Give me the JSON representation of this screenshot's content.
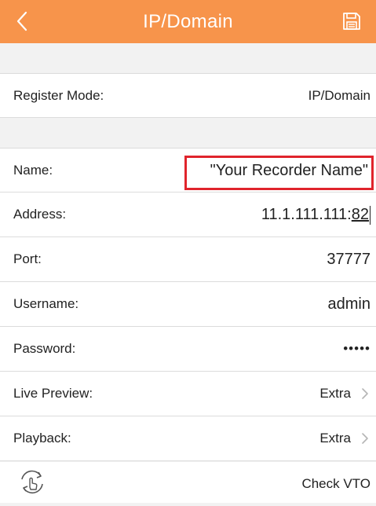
{
  "header": {
    "title": "IP/Domain",
    "back_icon": "chevron-left-icon",
    "save_icon": "save-icon",
    "color": "#f7944b"
  },
  "register": {
    "label": "Register Mode:",
    "value": "IP/Domain"
  },
  "fields": {
    "name": {
      "label": "Name:",
      "value": "\"Your Recorder Name\""
    },
    "address": {
      "label": "Address:",
      "value_main": "11.1.111.111:",
      "value_underlined": "82"
    },
    "port": {
      "label": "Port:",
      "value": "37777"
    },
    "username": {
      "label": "Username:",
      "value": "admin"
    },
    "password": {
      "label": "Password:",
      "value": "•••••"
    },
    "live_preview": {
      "label": "Live Preview:",
      "value": "Extra"
    },
    "playback": {
      "label": "Playback:",
      "value": "Extra"
    }
  },
  "bottom": {
    "check_label": "Check VTO",
    "icon": "rotate-hand-icon"
  },
  "highlight_color": "#e0242c"
}
